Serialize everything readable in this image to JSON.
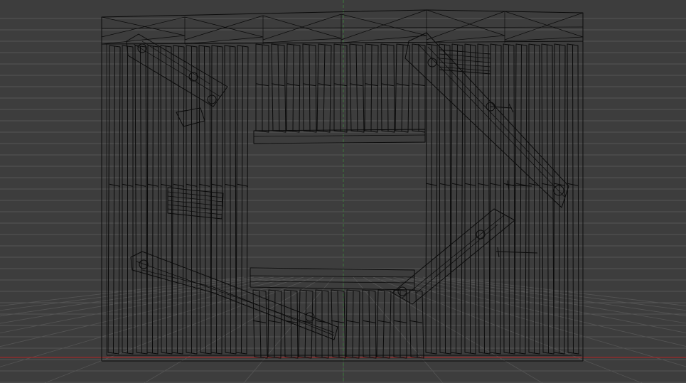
{
  "viewport": {
    "mode": "wireframe",
    "grid_visible": true,
    "background_color": "#3d3d3d",
    "grid_color": "#555555",
    "wire_color": "#0a0a0a",
    "x_axis_color": "#a02828",
    "y_axis_color": "#3c7a3c"
  },
  "model": {
    "type": "wooden plank frame",
    "icons": [
      "nail-icon",
      "nail-icon",
      "nail-icon"
    ]
  }
}
